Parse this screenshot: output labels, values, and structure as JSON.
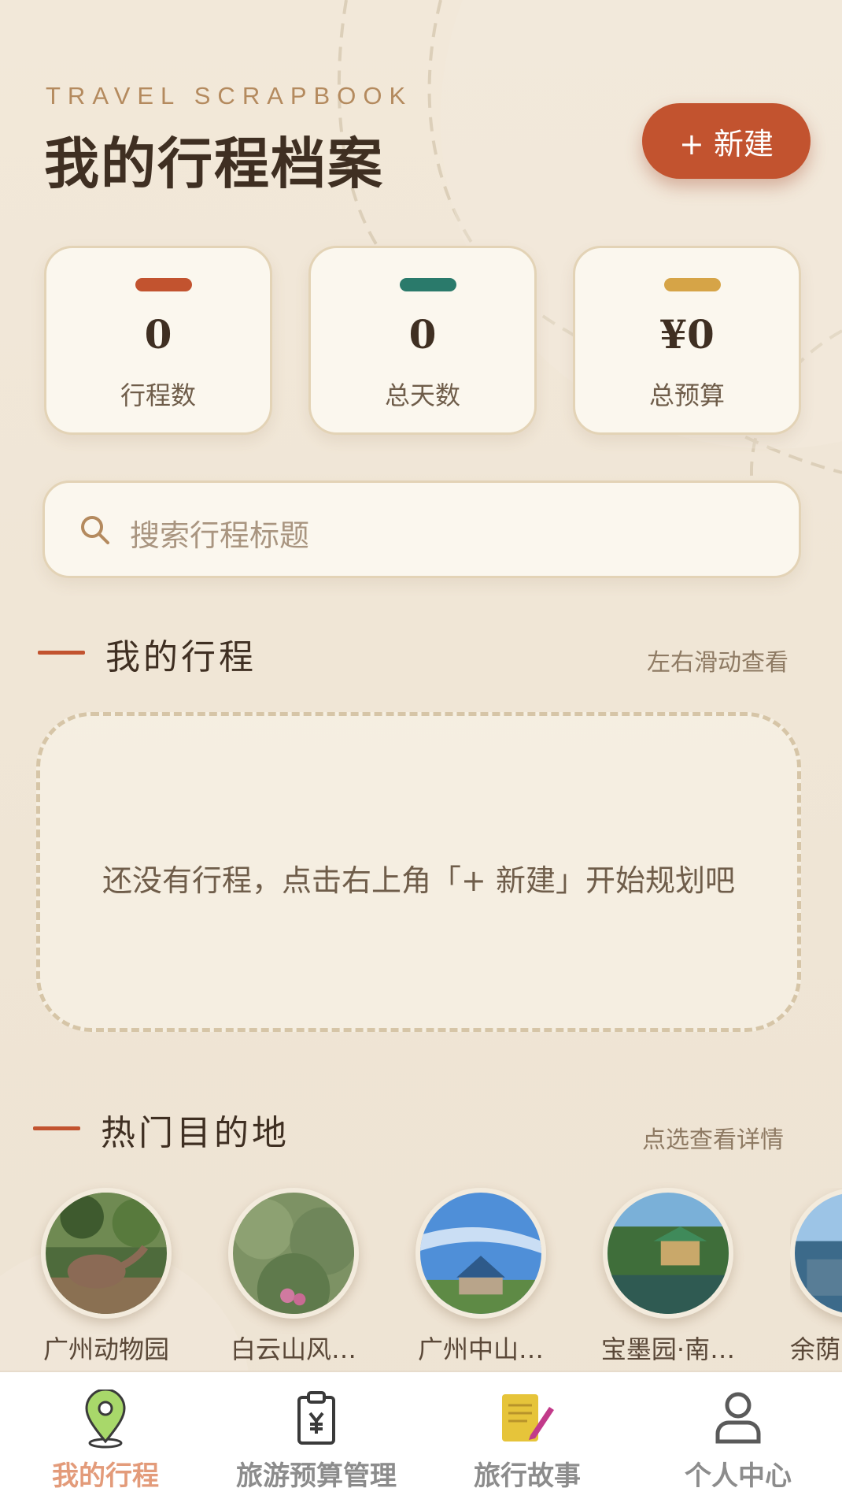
{
  "header": {
    "eyebrow": "TRAVEL SCRAPBOOK",
    "title": "我的行程档案",
    "new_button": "+ 新建"
  },
  "stats": [
    {
      "value": "0",
      "label": "行程数",
      "color": "#c2532f"
    },
    {
      "value": "0",
      "label": "总天数",
      "color": "#2a7a6b"
    },
    {
      "value": "¥0",
      "label": "总预算",
      "color": "#d6a447"
    }
  ],
  "search": {
    "placeholder": "搜索行程标题",
    "icon": "search-icon"
  },
  "my_trips": {
    "title": "我的行程",
    "hint": "左右滑动查看",
    "empty_message": "还没有行程，点击右上角「+ 新建」开始规划吧"
  },
  "destinations": {
    "title": "热门目的地",
    "hint": "点选查看详情",
    "items": [
      {
        "name": "广州动物园"
      },
      {
        "name": "白云山风…"
      },
      {
        "name": "广州中山…"
      },
      {
        "name": "宝墨园·南…"
      },
      {
        "name": "余荫"
      }
    ]
  },
  "bottom_nav": [
    {
      "label": "我的行程",
      "icon": "map-pin-icon",
      "active": true
    },
    {
      "label": "旅游预算管理",
      "icon": "budget-clipboard-icon",
      "active": false
    },
    {
      "label": "旅行故事",
      "icon": "notebook-pen-icon",
      "active": false
    },
    {
      "label": "个人中心",
      "icon": "person-icon",
      "active": false
    }
  ],
  "colors": {
    "accent": "#c2532f",
    "background": "#efe5d6",
    "card": "#fbf7ee"
  }
}
